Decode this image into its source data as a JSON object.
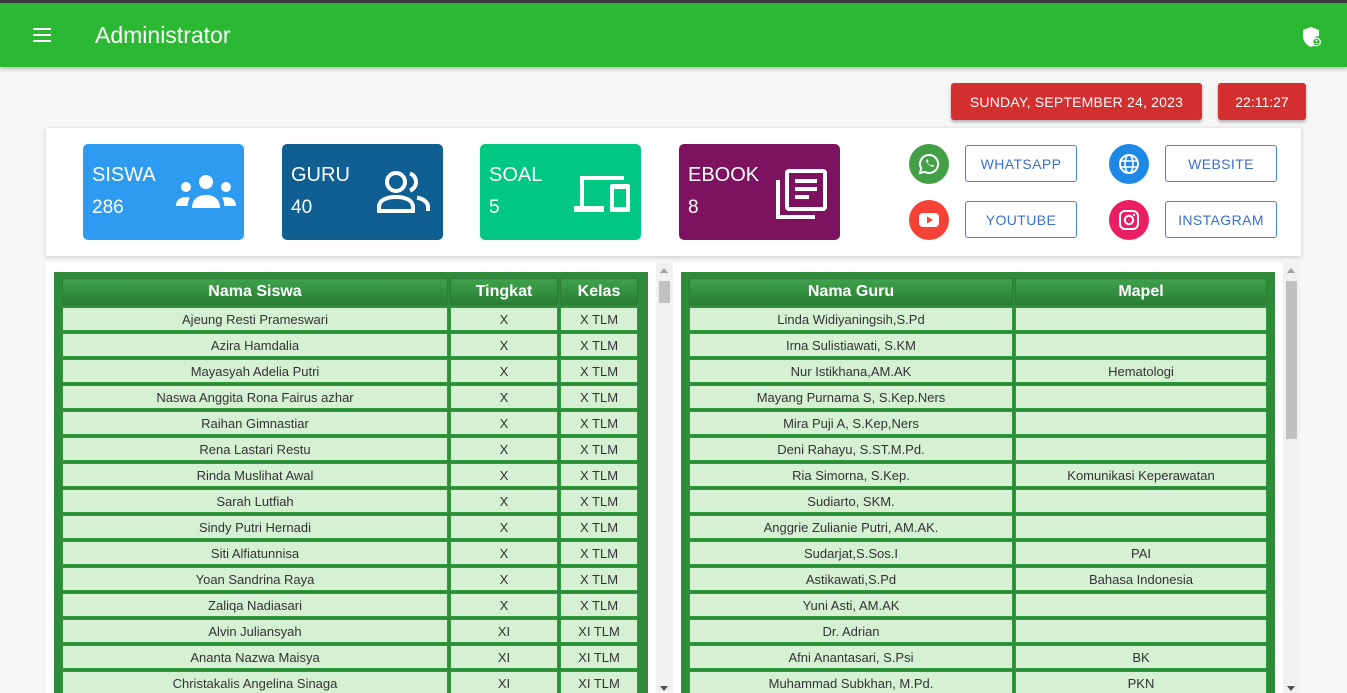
{
  "app": {
    "title": "Administrator"
  },
  "header": {
    "date": "SUNDAY, SEPTEMBER 24, 2023",
    "time": "22:11:27"
  },
  "stats": [
    {
      "label": "SISWA",
      "value": "286",
      "color": "#2d9bf0",
      "icon": "users-group-icon"
    },
    {
      "label": "GURU",
      "value": "40",
      "color": "#0f5f93",
      "icon": "people-outline-icon"
    },
    {
      "label": "SOAL",
      "value": "5",
      "color": "#00c781",
      "icon": "devices-icon"
    },
    {
      "label": "EBOOK",
      "value": "8",
      "color": "#7d1260",
      "icon": "library-books-icon"
    }
  ],
  "social": {
    "whatsapp": "WHATSAPP",
    "website": "WEBSITE",
    "youtube": "YOUTUBE",
    "instagram": "INSTAGRAM"
  },
  "students": {
    "headers": [
      "Nama Siswa",
      "Tingkat",
      "Kelas"
    ],
    "rows": [
      [
        "Ajeung Resti Prameswari",
        "X",
        "X TLM"
      ],
      [
        "Azira Hamdalia",
        "X",
        "X TLM"
      ],
      [
        "Mayasyah Adelia Putri",
        "X",
        "X TLM"
      ],
      [
        "Naswa Anggita Rona Fairus azhar",
        "X",
        "X TLM"
      ],
      [
        "Raihan Gimnastiar",
        "X",
        "X TLM"
      ],
      [
        "Rena Lastari Restu",
        "X",
        "X TLM"
      ],
      [
        "Rinda Muslihat Awal",
        "X",
        "X TLM"
      ],
      [
        "Sarah Lutfiah",
        "X",
        "X TLM"
      ],
      [
        "Sindy Putri Hernadi",
        "X",
        "X TLM"
      ],
      [
        "Siti Alfiatunnisa",
        "X",
        "X TLM"
      ],
      [
        "Yoan Sandrina Raya",
        "X",
        "X TLM"
      ],
      [
        "Zaliqa Nadiasari",
        "X",
        "X TLM"
      ],
      [
        "Alvin Juliansyah",
        "XI",
        "XI TLM"
      ],
      [
        "Ananta Nazwa Maisya",
        "XI",
        "XI TLM"
      ],
      [
        "Christakalis Angelina Sinaga",
        "XI",
        "XI TLM"
      ]
    ]
  },
  "teachers": {
    "headers": [
      "Nama Guru",
      "Mapel"
    ],
    "rows": [
      [
        "Linda Widiyaningsih,S.Pd",
        ""
      ],
      [
        "Irna Sulistiawati, S.KM",
        ""
      ],
      [
        "Nur Istikhana,AM.AK",
        "Hematologi"
      ],
      [
        "Mayang Purnama S, S.Kep.Ners",
        ""
      ],
      [
        "Mira Puji A, S.Kep,Ners",
        ""
      ],
      [
        "Deni Rahayu, S.ST.M.Pd.",
        ""
      ],
      [
        "Ria Simorna, S.Kep.",
        "Komunikasi Keperawatan"
      ],
      [
        "Sudiarto, SKM.",
        ""
      ],
      [
        "Anggrie Zulianie Putri, AM.AK.",
        ""
      ],
      [
        "Sudarjat,S.Sos.I",
        "PAI"
      ],
      [
        "Astikawati,S.Pd",
        "Bahasa Indonesia"
      ],
      [
        "Yuni Asti, AM.AK",
        ""
      ],
      [
        "Dr. Adrian",
        ""
      ],
      [
        "Afni Anantasari, S.Psi",
        "BK"
      ],
      [
        "Muhammad Subkhan, M.Pd.",
        "PKN"
      ]
    ]
  }
}
